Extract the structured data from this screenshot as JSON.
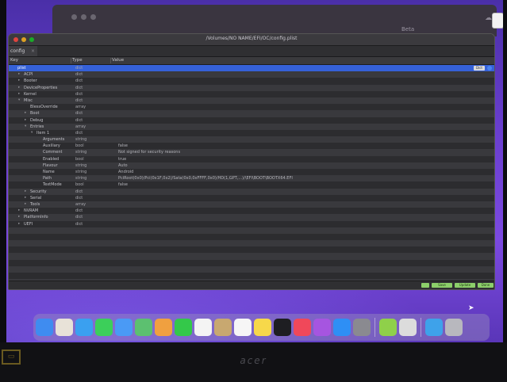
{
  "back_window": {
    "title": "Beta",
    "icon": "cloud-icon"
  },
  "window": {
    "path": "/Volumes/NO NAME/EFI/OC/config.plist",
    "tab_label": "config",
    "columns": {
      "key": "Key",
      "type": "Type",
      "value": "Value"
    }
  },
  "selected_chip": "Dict",
  "rows": [
    {
      "key": "plist",
      "type": "dict",
      "value": "",
      "indent": 0,
      "tri": "",
      "selected": true
    },
    {
      "key": "ACPI",
      "type": "dict",
      "value": "",
      "indent": 1,
      "tri": "▸"
    },
    {
      "key": "Booter",
      "type": "dict",
      "value": "",
      "indent": 1,
      "tri": "▸"
    },
    {
      "key": "DeviceProperties",
      "type": "dict",
      "value": "",
      "indent": 1,
      "tri": "▸"
    },
    {
      "key": "Kernel",
      "type": "dict",
      "value": "",
      "indent": 1,
      "tri": "▸"
    },
    {
      "key": "Misc",
      "type": "dict",
      "value": "",
      "indent": 1,
      "tri": "▾"
    },
    {
      "key": "BlessOverride",
      "type": "array",
      "value": "",
      "indent": 2,
      "tri": ""
    },
    {
      "key": "Boot",
      "type": "dict",
      "value": "",
      "indent": 2,
      "tri": "▸"
    },
    {
      "key": "Debug",
      "type": "dict",
      "value": "",
      "indent": 2,
      "tri": "▸"
    },
    {
      "key": "Entries",
      "type": "array",
      "value": "",
      "indent": 2,
      "tri": "▾"
    },
    {
      "key": "Item 1",
      "type": "dict",
      "value": "",
      "indent": 3,
      "tri": "▾"
    },
    {
      "key": "Arguments",
      "type": "string",
      "value": "",
      "indent": 4,
      "tri": ""
    },
    {
      "key": "Auxiliary",
      "type": "bool",
      "value": "false",
      "indent": 4,
      "tri": ""
    },
    {
      "key": "Comment",
      "type": "string",
      "value": "Not signed for security reasons",
      "indent": 4,
      "tri": ""
    },
    {
      "key": "Enabled",
      "type": "bool",
      "value": "true",
      "indent": 4,
      "tri": ""
    },
    {
      "key": "Flavour",
      "type": "string",
      "value": "Auto",
      "indent": 4,
      "tri": ""
    },
    {
      "key": "Name",
      "type": "string",
      "value": "Android",
      "indent": 4,
      "tri": ""
    },
    {
      "key": "Path",
      "type": "string",
      "value": "PciRoot(0x0)/Pci(0x1F,0x2)/Sata(0x0,0xFFFF,0x0)/HD(1,GPT,...)/\\EFI\\BOOT\\BOOTX64.EFI",
      "indent": 4,
      "tri": ""
    },
    {
      "key": "TextMode",
      "type": "bool",
      "value": "false",
      "indent": 4,
      "tri": ""
    },
    {
      "key": "Security",
      "type": "dict",
      "value": "",
      "indent": 2,
      "tri": "▸"
    },
    {
      "key": "Serial",
      "type": "dict",
      "value": "",
      "indent": 2,
      "tri": "▸"
    },
    {
      "key": "Tools",
      "type": "array",
      "value": "",
      "indent": 2,
      "tri": "▸"
    },
    {
      "key": "NVRAM",
      "type": "dict",
      "value": "",
      "indent": 1,
      "tri": "▸"
    },
    {
      "key": "PlatformInfo",
      "type": "dict",
      "value": "",
      "indent": 1,
      "tri": "▸"
    },
    {
      "key": "UEFI",
      "type": "dict",
      "value": "",
      "indent": 1,
      "tri": "▸"
    },
    {
      "key": "",
      "type": "",
      "value": "",
      "indent": 0,
      "tri": ""
    },
    {
      "key": "",
      "type": "",
      "value": "",
      "indent": 0,
      "tri": ""
    },
    {
      "key": "",
      "type": "",
      "value": "",
      "indent": 0,
      "tri": ""
    },
    {
      "key": "",
      "type": "",
      "value": "",
      "indent": 0,
      "tri": ""
    },
    {
      "key": "",
      "type": "",
      "value": "",
      "indent": 0,
      "tri": ""
    },
    {
      "key": "",
      "type": "",
      "value": "",
      "indent": 0,
      "tri": ""
    },
    {
      "key": "",
      "type": "",
      "value": "",
      "indent": 0,
      "tri": ""
    },
    {
      "key": "",
      "type": "",
      "value": "",
      "indent": 0,
      "tri": ""
    },
    {
      "key": "",
      "type": "",
      "value": "",
      "indent": 0,
      "tri": ""
    }
  ],
  "status_buttons": [
    "",
    "Save",
    "Update",
    "Done"
  ],
  "dock": [
    {
      "name": "finder-icon",
      "color": "#3f8cf0"
    },
    {
      "name": "launchpad-icon",
      "color": "#e8e2d8"
    },
    {
      "name": "safari-icon",
      "color": "#3aa0f0"
    },
    {
      "name": "messages-icon",
      "color": "#3ccf5a"
    },
    {
      "name": "mail-icon",
      "color": "#4a9af5"
    },
    {
      "name": "maps-icon",
      "color": "#5cc070"
    },
    {
      "name": "photos-icon",
      "color": "#f0a040"
    },
    {
      "name": "facetime-icon",
      "color": "#34c84a"
    },
    {
      "name": "calendar-icon",
      "color": "#f4f4f4"
    },
    {
      "name": "contacts-icon",
      "color": "#c8a870"
    },
    {
      "name": "reminders-icon",
      "color": "#f6f6f6"
    },
    {
      "name": "notes-icon",
      "color": "#f7d84a"
    },
    {
      "name": "tv-icon",
      "color": "#1e1e22"
    },
    {
      "name": "music-icon",
      "color": "#f0485a"
    },
    {
      "name": "podcasts-icon",
      "color": "#a655e0"
    },
    {
      "name": "app-store-icon",
      "color": "#2e8ff5"
    },
    {
      "name": "system-preferences-icon",
      "color": "#8a8a90"
    },
    {
      "name": "separator",
      "color": ""
    },
    {
      "name": "editor-app-icon",
      "color": "#8fd04a"
    },
    {
      "name": "terminal-icon",
      "color": "#dcdcdc"
    },
    {
      "name": "separator",
      "color": ""
    },
    {
      "name": "downloads-folder-icon",
      "color": "#3ea2ea"
    },
    {
      "name": "trash-icon",
      "color": "#b8b8be"
    }
  ],
  "bezel": {
    "brand": "acer",
    "port_label": "HDMI"
  }
}
